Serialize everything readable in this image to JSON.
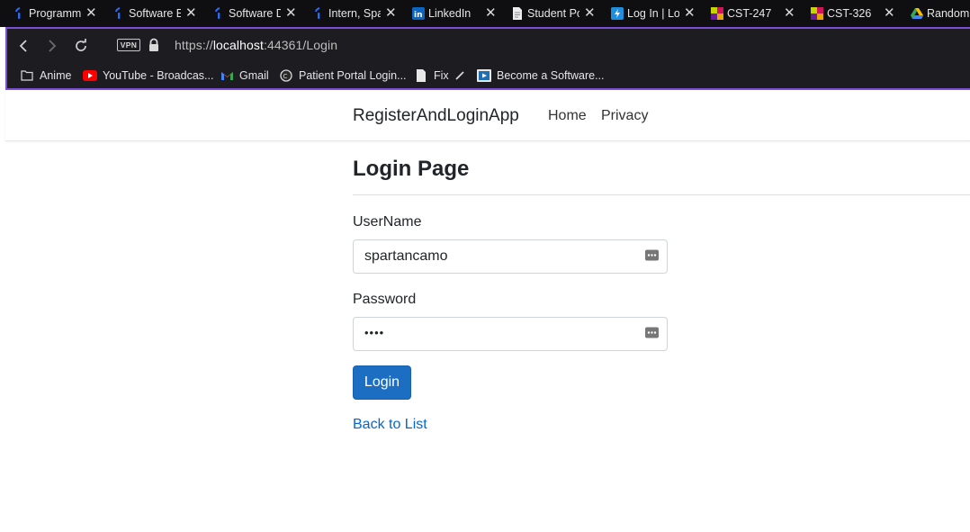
{
  "browser": {
    "tabs": [
      {
        "title": "Programm",
        "icon": "indeed-icon"
      },
      {
        "title": "Software E",
        "icon": "indeed-icon"
      },
      {
        "title": "Software D",
        "icon": "indeed-icon"
      },
      {
        "title": "Intern, Spa",
        "icon": "indeed-icon"
      },
      {
        "title": "LinkedIn",
        "icon": "linkedin-icon"
      },
      {
        "title": "Student Po",
        "icon": "document-icon"
      },
      {
        "title": "Log In | Lo",
        "icon": "bolt-icon"
      },
      {
        "title": "CST-247",
        "icon": "course-icon"
      },
      {
        "title": "CST-326",
        "icon": "course-icon"
      },
      {
        "title": "Random",
        "icon": "drive-icon"
      }
    ],
    "vpn_label": "VPN",
    "url_scheme": "https://",
    "url_host": "localhost",
    "url_rest": ":44361/Login",
    "bookmarks": [
      {
        "label": "Anime",
        "icon": "folder-icon"
      },
      {
        "label": "YouTube - Broadcas...",
        "icon": "youtube-icon"
      },
      {
        "label": "Gmail",
        "icon": "gmail-icon"
      },
      {
        "label": "Patient Portal Login...",
        "icon": "portal-icon"
      },
      {
        "label": "Fix",
        "icon": "page-icon"
      },
      {
        "label": "Become a Software...",
        "icon": "video-icon"
      }
    ]
  },
  "app": {
    "brand": "RegisterAndLoginApp",
    "nav": [
      {
        "label": "Home"
      },
      {
        "label": "Privacy"
      }
    ],
    "page_title": "Login Page",
    "username_label": "UserName",
    "username_value": "spartancamo",
    "password_label": "Password",
    "password_mask": "••••",
    "login_button": "Login",
    "back_link": "Back to List"
  },
  "colors": {
    "primary": "#1b6ec2",
    "link": "#0366d6",
    "chrome_bg": "#1d1d21",
    "accent": "#7a4fd6"
  }
}
